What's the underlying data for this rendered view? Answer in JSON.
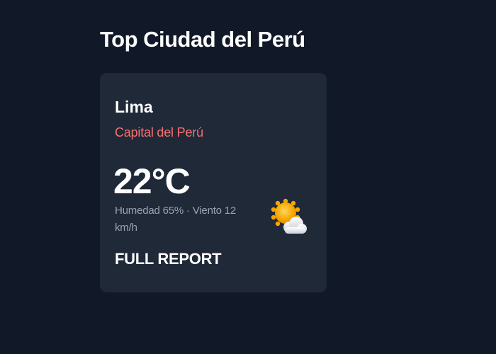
{
  "section": {
    "title": "Top Ciudad del Perú"
  },
  "card": {
    "city": "Lima",
    "subtitle": "Capital del Perú",
    "temperature": "22°C",
    "details": "Humedad 65% · Viento 12 km/h",
    "icon": "sun-behind-cloud-icon",
    "action_label": "FULL REPORT"
  },
  "colors": {
    "background": "#111827",
    "card": "#1f2937",
    "subtitle": "#f87171",
    "muted_text": "#9ca3af"
  }
}
